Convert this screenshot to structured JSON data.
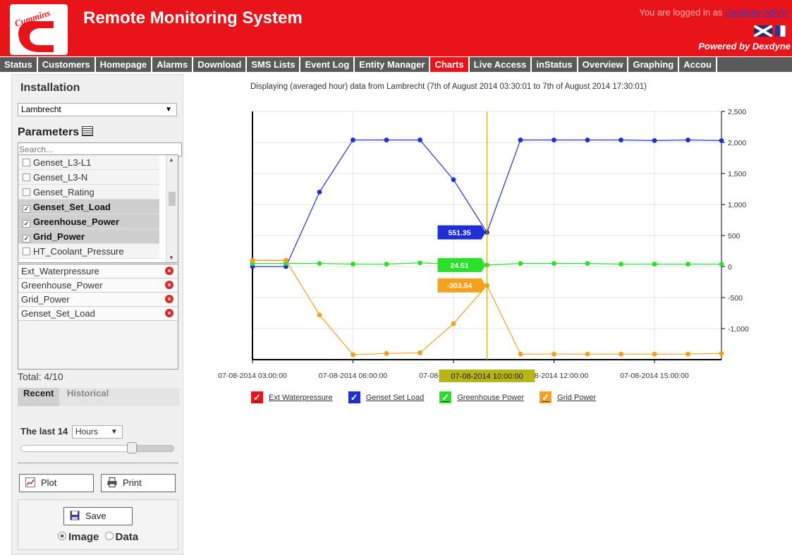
{
  "header": {
    "logo_text": "Cummins",
    "title": "Remote Monitoring System",
    "login_prefix": "You are logged in as ",
    "user": "Dexdyne Admin",
    "powered_by": "Powered by Dexdyne"
  },
  "nav": [
    {
      "label": "Status"
    },
    {
      "label": "Customers"
    },
    {
      "label": "Homepage"
    },
    {
      "label": "Alarms"
    },
    {
      "label": "Download"
    },
    {
      "label": "SMS Lists"
    },
    {
      "label": "Event Log"
    },
    {
      "label": "Entity Manager"
    },
    {
      "label": "Charts",
      "active": true
    },
    {
      "label": "Live Access"
    },
    {
      "label": "inStatus"
    },
    {
      "label": "Overview"
    },
    {
      "label": "Graphing"
    },
    {
      "label": "Accou"
    }
  ],
  "sidebar": {
    "installation_title": "Installation",
    "installation_value": "Lambrecht",
    "parameters_title": "Parameters",
    "search_placeholder": "Search...",
    "params": [
      {
        "label": "Genset_L3-L1",
        "checked": false
      },
      {
        "label": "Genset_L3-N",
        "checked": false
      },
      {
        "label": "Genset_Rating",
        "checked": false
      },
      {
        "label": "Genset_Set_Load",
        "checked": true
      },
      {
        "label": "Greenhouse_Power",
        "checked": true
      },
      {
        "label": "Grid_Power",
        "checked": true
      },
      {
        "label": "HT_Coolant_Pressure",
        "checked": false
      }
    ],
    "selected": [
      "Ext_Waterpressure",
      "Greenhouse_Power",
      "Grid_Power",
      "Genset_Set_Load"
    ],
    "total": "Total: 4/10",
    "tab_recent": "Recent",
    "tab_historical": "Historical",
    "range_prefix": "The last 14",
    "range_unit": "Hours",
    "slider_value": 0.75,
    "plot_label": "Plot",
    "print_label": "Print",
    "save_label": "Save",
    "radio_image": "Image",
    "radio_data": "Data"
  },
  "chart_caption": "Displaying (averaged hour) data from Lambrecht (7th of August 2014 03:30:01 to 7th of August 2014 17:30:01)",
  "chart_data": {
    "type": "line",
    "x": [
      "03:00",
      "04:00",
      "05:00",
      "06:00",
      "07:00",
      "08:00",
      "09:00",
      "10:00",
      "11:00",
      "12:00",
      "13:00",
      "14:00",
      "15:00",
      "16:00",
      "17:00"
    ],
    "xticks": [
      "07-08-2014 03:00:00",
      "07-08-2014 06:00:00",
      "07-08-2014 09:00:00",
      "07-08-2014 12:00:00",
      "07-08-2014 15:00:00"
    ],
    "xtick_hours": [
      3,
      6,
      9,
      12,
      15
    ],
    "ylim": [
      -1500,
      2500
    ],
    "yticks": [
      2500,
      2000,
      1500,
      1000,
      500,
      0,
      -500,
      -1000
    ],
    "ytick_labels": [
      "2,500",
      "2,000",
      "1,500",
      "1,000",
      "500",
      "0",
      "-500",
      "-1,000"
    ],
    "grid": true,
    "series": [
      {
        "name": "Ext_Waterpressure",
        "color": "#e8141a",
        "values": [
          100,
          100,
          null,
          null,
          null,
          null,
          null,
          null,
          null,
          null,
          null,
          null,
          null,
          null,
          null
        ]
      },
      {
        "name": "Genset_Set_Load",
        "color": "#1f2fd6",
        "values": [
          0,
          0,
          1200,
          2040,
          2040,
          2040,
          1400,
          551.35,
          2040,
          2040,
          2040,
          2040,
          2030,
          2040,
          2030
        ]
      },
      {
        "name": "Greenhouse_Power",
        "color": "#2ae02a",
        "values": [
          50,
          50,
          50,
          40,
          40,
          60,
          40,
          24.51,
          50,
          50,
          50,
          40,
          40,
          40,
          40
        ]
      },
      {
        "name": "Grid_Power",
        "color": "#f5a01e",
        "values": [
          100,
          100,
          -780,
          -1420,
          -1400,
          -1390,
          -920,
          -303.54,
          -1410,
          -1410,
          -1410,
          -1410,
          -1410,
          -1410,
          -1400
        ]
      }
    ],
    "cursor_x": "07-08-2014 10:00:00",
    "cursor_index": 7,
    "tooltips": [
      {
        "text": "551.35",
        "color": "#1f2fd6"
      },
      {
        "text": "24.51",
        "color": "#2ae02a"
      },
      {
        "text": "-303.54",
        "color": "#f5a01e"
      }
    ],
    "crosshair_color": "#c9a21a",
    "cursor_label_color": "#b5b515",
    "legend": [
      {
        "label": "Ext Waterpressure",
        "color": "#e8141a"
      },
      {
        "label": "Genset Set Load",
        "color": "#1f2fd6"
      },
      {
        "label": "Greenhouse Power",
        "color": "#2ae02a"
      },
      {
        "label": "Grid Power",
        "color": "#f5a01e"
      }
    ]
  }
}
